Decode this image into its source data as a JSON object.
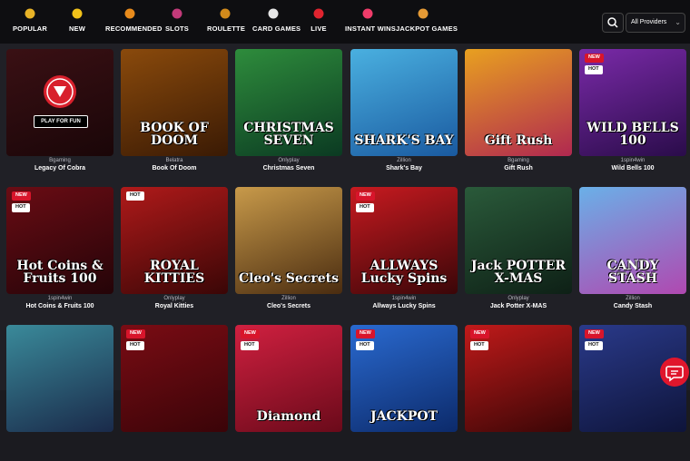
{
  "nav": {
    "categories": [
      {
        "label": "POPULAR",
        "icon": "crown-icon",
        "color": "#e8b327"
      },
      {
        "label": "NEW",
        "icon": "lightning-icon",
        "color": "#f2c21a"
      },
      {
        "label": "RECOMMENDED",
        "icon": "medal-icon",
        "color": "#e88b1c"
      },
      {
        "label": "SLOTS",
        "icon": "slot-machine-icon",
        "color": "#c23a7a"
      },
      {
        "label": "ROULETTE",
        "icon": "roulette-wheel-icon",
        "color": "#d28a1b"
      },
      {
        "label": "CARD GAMES",
        "icon": "playing-cards-icon",
        "color": "#e6e6e6"
      },
      {
        "label": "LIVE",
        "icon": "poker-chip-icon",
        "color": "#e0242f"
      },
      {
        "label": "INSTANT WINS",
        "icon": "heart-icon",
        "color": "#ef3c6a"
      },
      {
        "label": "JACKPOT GAMES",
        "icon": "money-bag-icon",
        "color": "#e59a35"
      }
    ],
    "search_icon": "search-icon",
    "provider_select": "All Providers"
  },
  "games": [
    {
      "provider": "Bgaming",
      "name": "Legacy Of Cobra",
      "art": "",
      "badges": [],
      "featured": true,
      "play_label": "PLAY FOR FUN",
      "bg1": "#3a1014",
      "bg2": "#1a0608"
    },
    {
      "provider": "Belatra",
      "name": "Book Of Doom",
      "art": "BOOK OF DOOM",
      "badges": [],
      "bg1": "#8a4a0c",
      "bg2": "#3a1a04"
    },
    {
      "provider": "Onlyplay",
      "name": "Christmas Seven",
      "art": "CHRISTMAS SEVEN",
      "badges": [],
      "bg1": "#2e8c3c",
      "bg2": "#0b3a22"
    },
    {
      "provider": "Zillion",
      "name": "Shark's Bay",
      "art": "SHARK'S BAY",
      "badges": [],
      "bg1": "#4ab0e0",
      "bg2": "#1a5aa0"
    },
    {
      "provider": "Bgaming",
      "name": "Gift Rush",
      "art": "Gift Rush",
      "badges": [],
      "bg1": "#e8a020",
      "bg2": "#b02850"
    },
    {
      "provider": "1spin4win",
      "name": "Wild Bells 100",
      "art": "WILD BELLS 100",
      "badges": [
        "NEW",
        "HOT"
      ],
      "bg1": "#7a2aa8",
      "bg2": "#2a0c4a"
    },
    {
      "provider": "1spin4win",
      "name": "Hot Coins & Fruits 100",
      "art": "Hot Coins & Fruits 100",
      "badges": [
        "NEW",
        "HOT"
      ],
      "bg1": "#6a0c14",
      "bg2": "#240408"
    },
    {
      "provider": "Onlyplay",
      "name": "Royal Kitties",
      "art": "ROYAL KITTIES",
      "badges": [
        "HOT"
      ],
      "bg1": "#b01a1a",
      "bg2": "#3a0606"
    },
    {
      "provider": "Zillion",
      "name": "Cleo's Secrets",
      "art": "Cleo's Secrets",
      "badges": [],
      "bg1": "#c89a4a",
      "bg2": "#4a2c10"
    },
    {
      "provider": "1spin4win",
      "name": "Allways Lucky Spins",
      "art": "ALLWAYS Lucky Spins",
      "badges": [
        "NEW",
        "HOT"
      ],
      "bg1": "#c81a20",
      "bg2": "#3a0608"
    },
    {
      "provider": "Onlyplay",
      "name": "Jack Potter X-MAS",
      "art": "Jack POTTER X-MAS",
      "badges": [],
      "bg1": "#2a5a3a",
      "bg2": "#0e2016"
    },
    {
      "provider": "Zillion",
      "name": "Candy Stash",
      "art": "CANDY STASH",
      "badges": [],
      "bg1": "#6ab0e8",
      "bg2": "#b048b0"
    },
    {
      "provider": "",
      "name": "",
      "art": "",
      "badges": [],
      "bg1": "#3a8a9a",
      "bg2": "#1a2a4a"
    },
    {
      "provider": "",
      "name": "",
      "art": "",
      "badges": [
        "NEW",
        "HOT"
      ],
      "bg1": "#7a0c14",
      "bg2": "#3a0408"
    },
    {
      "provider": "",
      "name": "",
      "art": "Diamond",
      "badges": [
        "NEW",
        "HOT"
      ],
      "bg1": "#d02040",
      "bg2": "#6a0a1a"
    },
    {
      "provider": "",
      "name": "",
      "art": "JACKPOT",
      "badges": [
        "NEW",
        "HOT"
      ],
      "bg1": "#2a6ad0",
      "bg2": "#0c2a6a"
    },
    {
      "provider": "",
      "name": "",
      "art": "",
      "badges": [
        "NEW",
        "HOT"
      ],
      "bg1": "#c01a1a",
      "bg2": "#3a0606"
    },
    {
      "provider": "",
      "name": "",
      "art": "",
      "badges": [
        "NEW",
        "HOT"
      ],
      "bg1": "#2a3a8a",
      "bg2": "#0e143a"
    }
  ],
  "chat_icon": "chat-bubble-icon"
}
